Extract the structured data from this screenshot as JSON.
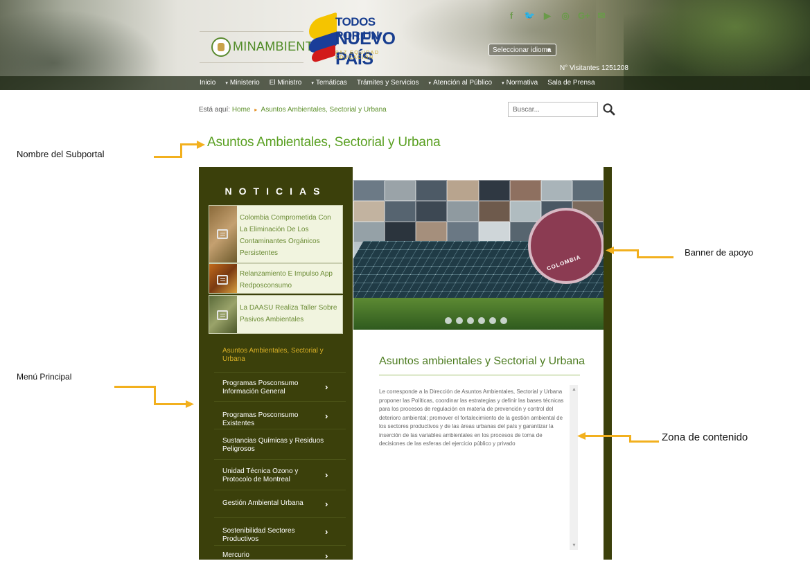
{
  "header": {
    "ministry_name": "MINAMBIENTE",
    "slogan_line1": "TODOS POR UN",
    "slogan_line2": "NUEVO PAÍS",
    "slogan_line3": "PAZ  EQUIDAD  EDUCACIÓN",
    "social_icons": [
      "facebook-icon",
      "twitter-icon",
      "youtube-icon",
      "instagram-icon",
      "googleplus-icon",
      "mail-icon"
    ],
    "social_glyphs": [
      "f",
      "🐦",
      "▶",
      "◎",
      "G+",
      "✉"
    ],
    "language_select": "Seleccionar idioma",
    "visitors": "N° Visitantes 1251208"
  },
  "nav": {
    "items": [
      "Inicio",
      "Ministerio",
      "El Ministro",
      "Temáticas",
      "Trámites y Servicios",
      "Atención al Público",
      "Normativa",
      "Sala de Prensa"
    ],
    "dropdown_marker": "▾"
  },
  "breadcrumb": {
    "prefix": "Está aquí:",
    "home": "Home",
    "current": "Asuntos Ambientales, Sectorial y Urbana",
    "separator": "▸"
  },
  "search": {
    "placeholder": "Buscar..."
  },
  "subportal_title": "Asuntos Ambientales, Sectorial y Urbana",
  "noticias": {
    "title": "NOTICIAS",
    "items": [
      "Colombia Comprometida Con La Eliminación De Los Contaminantes Orgánicos Persistentes",
      "Relanzamiento E Impulso App Redposconsumo",
      "La DAASU Realiza Taller Sobre Pasivos Ambientales"
    ]
  },
  "menu": {
    "active": "Asuntos Ambientales, Sectorial y Urbana",
    "items": [
      "Programas Posconsumo Información General",
      "Programas Posconsumo Existentes",
      "Sustancias Químicas y Residuos Peligrosos",
      "Unidad Técnica Ozono y Protocolo de Montreal",
      "Gestión Ambiental Urbana",
      "Sostenibilidad Sectores Productivos",
      "Mercurio"
    ],
    "chevron": "›"
  },
  "banner": {
    "stamp_text": "COLOMBIA",
    "slides": 6
  },
  "content": {
    "title": "Asuntos ambientales y Sectorial y Urbana",
    "body": "Le corresponde a la Dirección de Asuntos Ambientales, Sectorial y Urbana proponer las Políticas, coordinar las estrategias y definir las bases técnicas para los procesos de regulación en materia de prevención y control del deterioro ambiental; promover el fortalecimiento de la gestión ambiental de los sectores productivos y de las áreas urbanas del país y garantizar la inserción de las variables ambientales en los procesos de toma de decisiones de las esferas del ejercicio público y privado"
  },
  "annotations": {
    "subportal": "Nombre del Subportal",
    "menu": "Menú Principal",
    "banner": "Banner de apoyo",
    "content": "Zona de contenido"
  },
  "colors": {
    "panel": "#3b400b",
    "accent_green": "#5aa022",
    "annotation_orange": "#f2b01e"
  }
}
